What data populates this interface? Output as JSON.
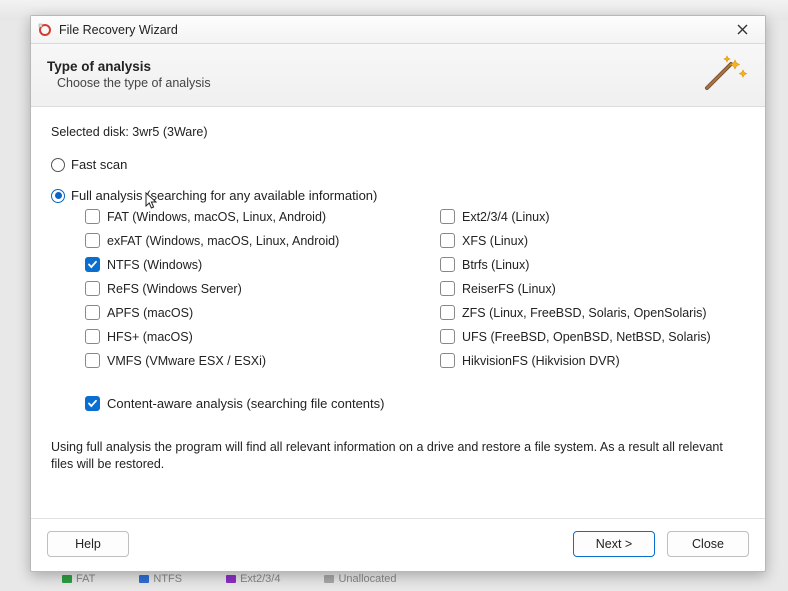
{
  "window": {
    "title": "File Recovery Wizard"
  },
  "header": {
    "title": "Type of analysis",
    "subtitle": "Choose the type of analysis"
  },
  "selected_disk_label": "Selected disk: 3wr5 (3Ware)",
  "radios": {
    "fast": {
      "label": "Fast scan",
      "selected": false
    },
    "full": {
      "label": "Full analysis (searching for any available information)",
      "selected": true
    }
  },
  "fs_left": [
    {
      "label": "FAT (Windows, macOS, Linux, Android)",
      "checked": false
    },
    {
      "label": "exFAT (Windows, macOS, Linux, Android)",
      "checked": false
    },
    {
      "label": "NTFS (Windows)",
      "checked": true
    },
    {
      "label": "ReFS (Windows Server)",
      "checked": false
    },
    {
      "label": "APFS (macOS)",
      "checked": false
    },
    {
      "label": "HFS+ (macOS)",
      "checked": false
    },
    {
      "label": "VMFS (VMware ESX / ESXi)",
      "checked": false
    }
  ],
  "fs_right": [
    {
      "label": "Ext2/3/4 (Linux)",
      "checked": false
    },
    {
      "label": "XFS (Linux)",
      "checked": false
    },
    {
      "label": "Btrfs (Linux)",
      "checked": false
    },
    {
      "label": "ReiserFS (Linux)",
      "checked": false
    },
    {
      "label": "ZFS (Linux, FreeBSD, Solaris, OpenSolaris)",
      "checked": false
    },
    {
      "label": "UFS (FreeBSD, OpenBSD, NetBSD, Solaris)",
      "checked": false
    },
    {
      "label": "HikvisionFS (Hikvision DVR)",
      "checked": false
    }
  ],
  "content_aware": {
    "label": "Content-aware analysis (searching file contents)",
    "checked": true
  },
  "description": "Using full analysis the program will find all relevant information on a drive and restore a file system. As a result all relevant files will be restored.",
  "buttons": {
    "help": "Help",
    "next": "Next >",
    "close": "Close"
  },
  "background_legend": [
    {
      "label": "FAT",
      "color": "#2e9e3f"
    },
    {
      "label": "NTFS",
      "color": "#2e6fd6"
    },
    {
      "label": "Ext2/3/4",
      "color": "#8d2fc6"
    },
    {
      "label": "Unallocated",
      "color": "#a8a8a8"
    }
  ],
  "colors": {
    "accent": "#0a6ed1"
  }
}
